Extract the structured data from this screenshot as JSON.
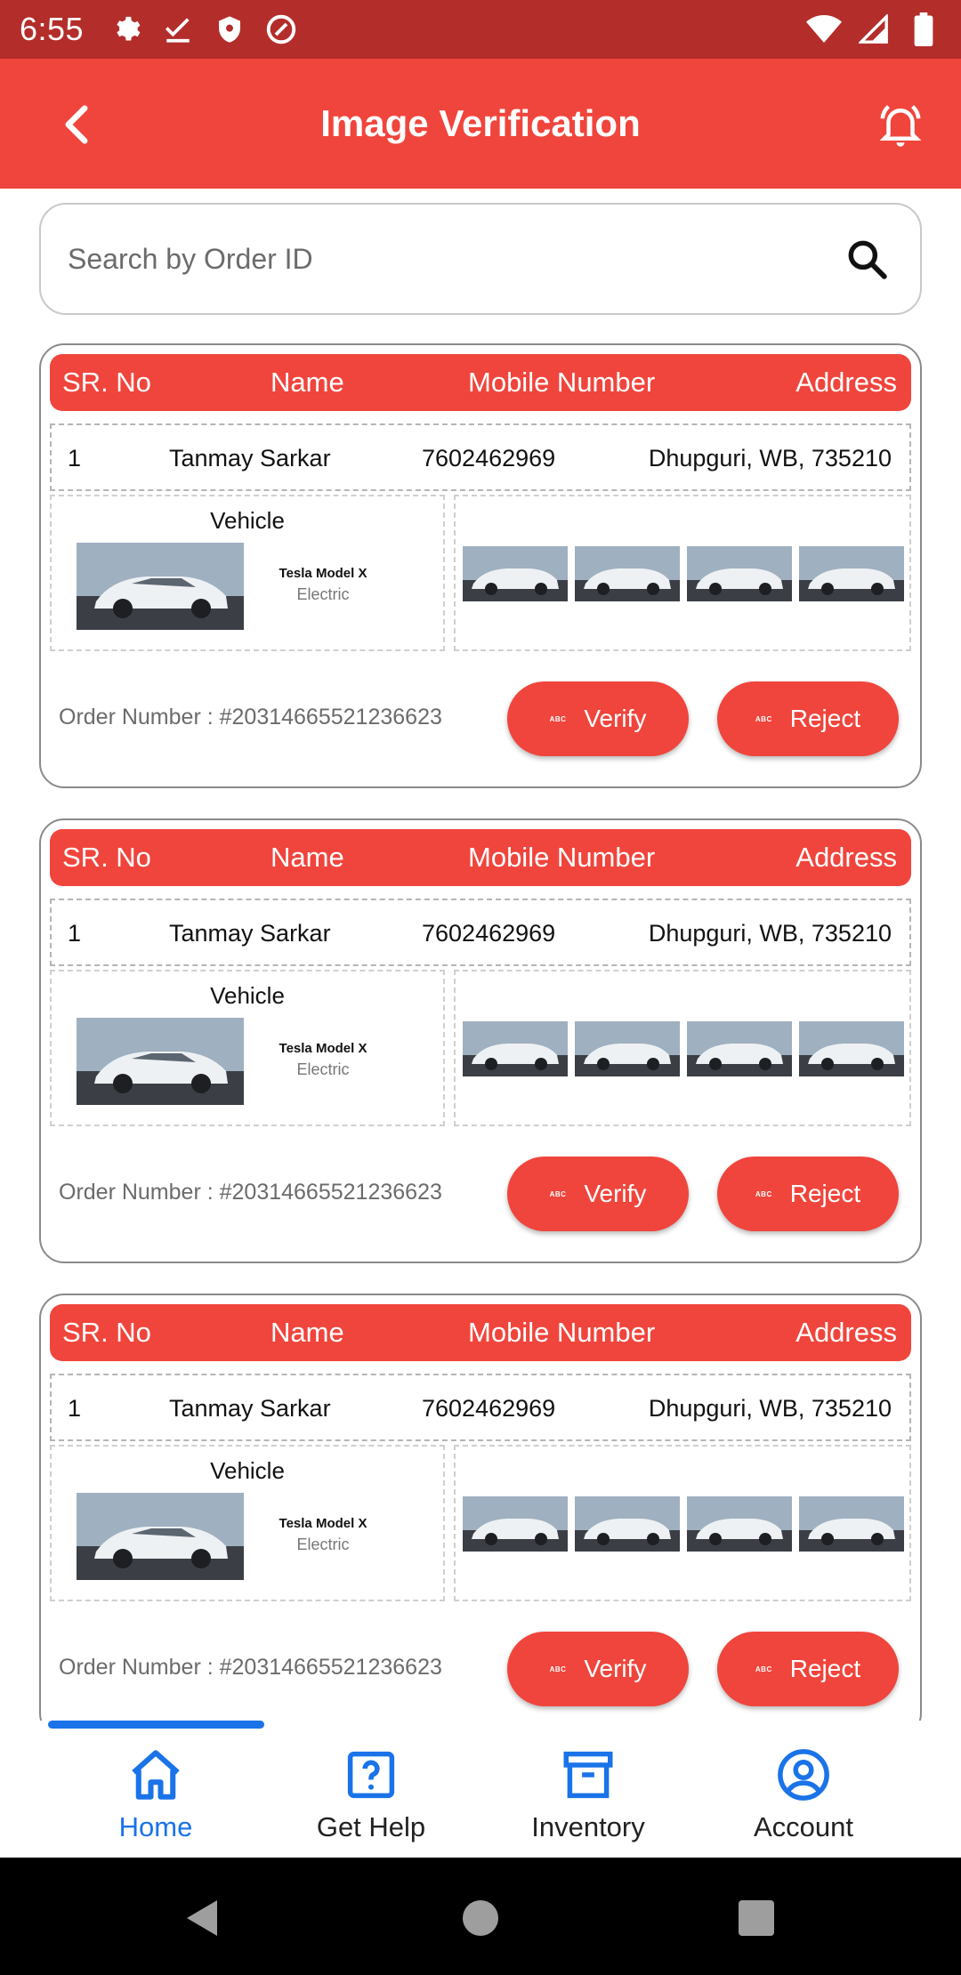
{
  "status_bar": {
    "time": "6:55"
  },
  "app_bar": {
    "title": "Image Verification"
  },
  "search": {
    "placeholder": "Search by Order ID"
  },
  "table_headers": {
    "sr": "SR. No",
    "name": "Name",
    "mobile": "Mobile Number",
    "address": "Address"
  },
  "cards": [
    {
      "sr": "1",
      "name": "Tanmay Sarkar",
      "mobile": "7602462969",
      "address": "Dhupguri, WB, 735210",
      "vehicle_title": "Vehicle",
      "vehicle_model": "Tesla Model X",
      "vehicle_type": "Electric",
      "order": "Order Number : #20314665521236623",
      "verify_label": "Verify",
      "reject_label": "Reject",
      "button_icon_text": "ABC"
    },
    {
      "sr": "1",
      "name": "Tanmay Sarkar",
      "mobile": "7602462969",
      "address": "Dhupguri, WB, 735210",
      "vehicle_title": "Vehicle",
      "vehicle_model": "Tesla Model X",
      "vehicle_type": "Electric",
      "order": "Order Number : #20314665521236623",
      "verify_label": "Verify",
      "reject_label": "Reject",
      "button_icon_text": "ABC"
    },
    {
      "sr": "1",
      "name": "Tanmay Sarkar",
      "mobile": "7602462969",
      "address": "Dhupguri, WB, 735210",
      "vehicle_title": "Vehicle",
      "vehicle_model": "Tesla Model X",
      "vehicle_type": "Electric",
      "order": "Order Number : #20314665521236623",
      "verify_label": "Verify",
      "reject_label": "Reject",
      "button_icon_text": "ABC"
    }
  ],
  "bottom_nav": {
    "items": [
      {
        "label": "Home",
        "icon": "home-icon",
        "active": true
      },
      {
        "label": "Get Help",
        "icon": "help-icon",
        "active": false
      },
      {
        "label": "Inventory",
        "icon": "archive-icon",
        "active": false
      },
      {
        "label": "Account",
        "icon": "account-icon",
        "active": false
      }
    ]
  },
  "colors": {
    "primary": "#f0453c",
    "status_bar": "#b32d2a",
    "active_nav": "#1a73e8"
  }
}
